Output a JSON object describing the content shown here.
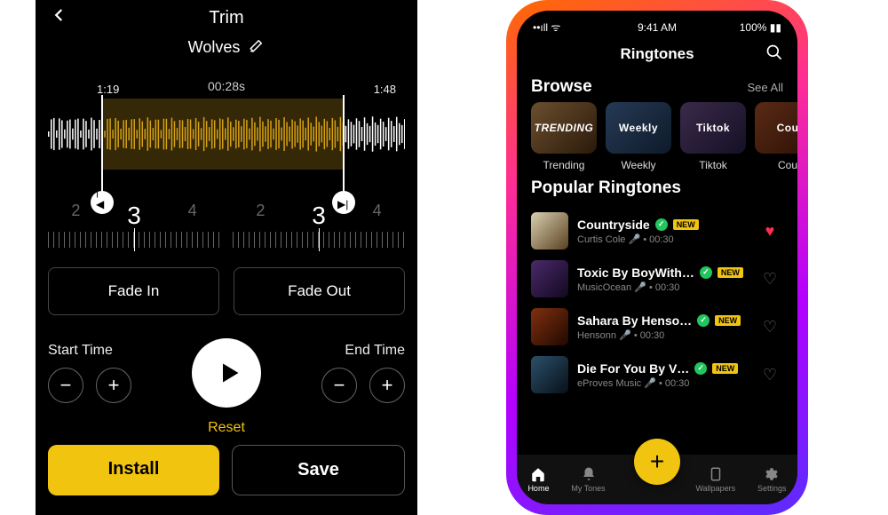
{
  "left": {
    "title": "Trim",
    "song": "Wolves",
    "duration": "00:28s",
    "wave_start": "1:19",
    "wave_end": "1:48",
    "ruler_left": {
      "a": "2",
      "b": "3",
      "c": "4"
    },
    "ruler_right": {
      "a": "2",
      "b": "3",
      "c": "4"
    },
    "fade_in": "Fade In",
    "fade_out": "Fade Out",
    "start_label": "Start Time",
    "end_label": "End Time",
    "reset": "Reset",
    "install": "Install",
    "save": "Save"
  },
  "right": {
    "status": {
      "time": "9:41 AM",
      "battery": "100%"
    },
    "title": "Ringtones",
    "browse": "Browse",
    "see_all": "See All",
    "cats": [
      {
        "badge": "TRENDING",
        "label": "Trending"
      },
      {
        "badge": "Weekly",
        "label": "Weekly"
      },
      {
        "badge": "Tiktok",
        "label": "Tiktok"
      },
      {
        "badge": "Cou",
        "label": "Cou"
      }
    ],
    "popular": "Popular Ringtones",
    "new_badge": "NEW",
    "rows": [
      {
        "title": "Countryside",
        "sub": "Curtis Cole 🎤 • 00:30",
        "fav": true
      },
      {
        "title": "Toxic By BoyWith…",
        "sub": "MusicOcean 🎤 • 00:30",
        "fav": false
      },
      {
        "title": "Sahara By Henso…",
        "sub": "Hensonn 🎤 • 00:30",
        "fav": false
      },
      {
        "title": "Die For You By V…",
        "sub": "eProves Music 🎤 • 00:30",
        "fav": false
      }
    ],
    "tabs": [
      {
        "label": "Home"
      },
      {
        "label": "My Tones"
      },
      {
        "label": "Wallpapers"
      },
      {
        "label": "Settings"
      }
    ]
  }
}
